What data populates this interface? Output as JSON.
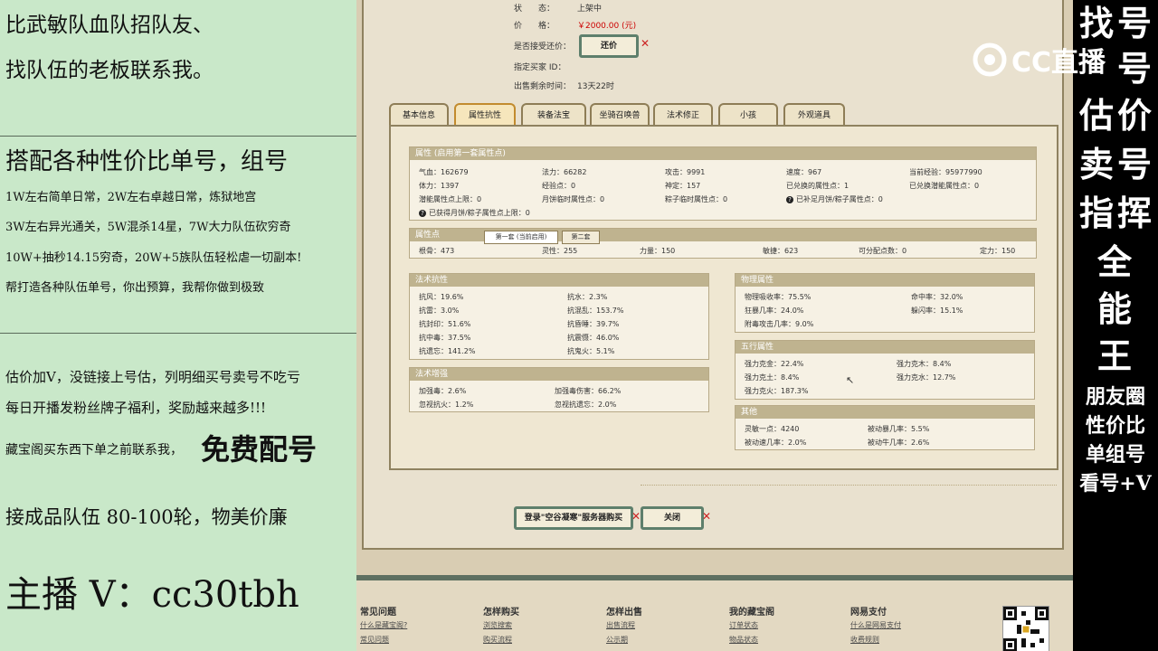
{
  "left_panel": {
    "lines": [
      "比武敏队血队招队友、",
      "找队伍的老板联系我。",
      "搭配各种性价比单号，组号",
      "1W左右简单日常，2W左右卓越日常，炼狱地宫",
      "3W左右异光通关，5W混杀14星，7W大力队伍砍穷奇",
      "10W+抽秒14.15穷奇，20W+5族队伍轻松虐一切副本!",
      "帮打造各种队伍单号，你出预算，我帮你做到极致",
      "估价加V，没链接上号估，列明细买号卖号不吃亏",
      "每日开播发粉丝牌子福利，奖励越来越多!!!",
      "藏宝阁买东西下单之前联系我，",
      "免费配号",
      "接成品队伍 80-100轮，物美价廉",
      "主播 V：cc30tbh"
    ]
  },
  "right_panel": {
    "vertical_text": [
      "找",
      "号",
      "估",
      "价",
      "卖",
      "号",
      "指",
      "挥",
      "全",
      "能",
      "王"
    ],
    "bottom_lines": [
      "朋友圈",
      "性价比",
      "单组号",
      "看号+V"
    ],
    "overlay_text": "号"
  },
  "logo": {
    "text": "CC直播"
  },
  "listing": {
    "status_label": "状　　态：",
    "status_value": "上架中",
    "price_label": "价　　格：",
    "price_value": "￥2000.00 (元)",
    "bargain_label": "是否接受还价：",
    "bargain_button": "还价",
    "buyer_label": "指定买家 ID：",
    "buyer_value": "",
    "remaining_label": "出售剩余时间：",
    "remaining_value": "13天22时"
  },
  "tabs": [
    {
      "label": "基本信息",
      "active": false
    },
    {
      "label": "属性抗性",
      "active": true
    },
    {
      "label": "装备法宝",
      "active": false
    },
    {
      "label": "坐骑召唤兽",
      "active": false
    },
    {
      "label": "法术修正",
      "active": false
    },
    {
      "label": "小孩",
      "active": false
    },
    {
      "label": "外观道具",
      "active": false
    }
  ],
  "attributes": {
    "title": "属性 (启用第一套属性点)",
    "rows": [
      [
        "气血：162679",
        "法力：66282",
        "攻击：9991",
        "速度：967",
        "当前经验：95977990"
      ],
      [
        "体力：1397",
        "经验点：0",
        "神定：157",
        "已兑换的属性点：1",
        "已兑换潜能属性点：0"
      ],
      [
        "潜能属性点上限：0",
        "月饼临时属性点：0",
        "粽子临时属性点：0",
        "已补足月饼/粽子属性点：0",
        ""
      ]
    ],
    "note": "已获得月饼/粽子属性点上限：0"
  },
  "points": {
    "title": "属性点",
    "subtabs": [
      "第一套 (当前启用)",
      "第二套"
    ],
    "values": [
      "根骨：473",
      "灵性：255",
      "力量：150",
      "敏捷：623",
      "可分配点数：0",
      "定力：150"
    ]
  },
  "spell_resist": {
    "title": "法术抗性",
    "rows": [
      [
        "抗风：19.6%",
        "抗水：2.3%"
      ],
      [
        "抗雷：3.0%",
        "抗混乱：153.7%"
      ],
      [
        "抗封印：51.6%",
        "抗昏睡：39.7%"
      ],
      [
        "抗中毒：37.5%",
        "抗震慑：46.0%"
      ],
      [
        "抗遗忘：141.2%",
        "抗鬼火：5.1%"
      ]
    ]
  },
  "spell_boost": {
    "title": "法术增强",
    "rows": [
      [
        "加强毒：2.6%",
        "加强毒伤害：66.2%"
      ],
      [
        "忽视抗火：1.2%",
        "忽视抗遗忘：2.0%"
      ]
    ]
  },
  "physical": {
    "title": "物理属性",
    "rows": [
      [
        "物理吸收率：75.5%",
        "命中率：32.0%"
      ],
      [
        "狂暴几率：24.0%",
        "躲闪率：15.1%"
      ],
      [
        "附毒攻击几率：9.0%",
        ""
      ]
    ]
  },
  "elements": {
    "title": "五行属性",
    "rows": [
      [
        "强力克金：22.4%",
        "强力克木：8.4%"
      ],
      [
        "强力克土：8.4%",
        "强力克水：12.7%"
      ],
      [
        "强力克火：187.3%",
        ""
      ]
    ]
  },
  "other": {
    "title": "其他",
    "rows": [
      [
        "灵敏一点：4240",
        "被动暴几率：5.5%"
      ],
      [
        "被动速几率：2.0%",
        "被动牛几率：2.6%"
      ]
    ]
  },
  "actions": {
    "login_buy": "登录\"空谷凝寒\"服务器购买",
    "close": "关闭"
  },
  "footer": {
    "columns": [
      {
        "title": "常见问题",
        "links": [
          "什么是藏宝阁?",
          "常见问题"
        ]
      },
      {
        "title": "怎样购买",
        "links": [
          "浏览搜索",
          "购买流程"
        ]
      },
      {
        "title": "怎样出售",
        "links": [
          "出售流程",
          "公示期"
        ]
      },
      {
        "title": "我的藏宝阁",
        "links": [
          "订单状态",
          "物品状态"
        ]
      },
      {
        "title": "网易支付",
        "links": [
          "什么是网易支付",
          "收费规则"
        ]
      }
    ]
  }
}
